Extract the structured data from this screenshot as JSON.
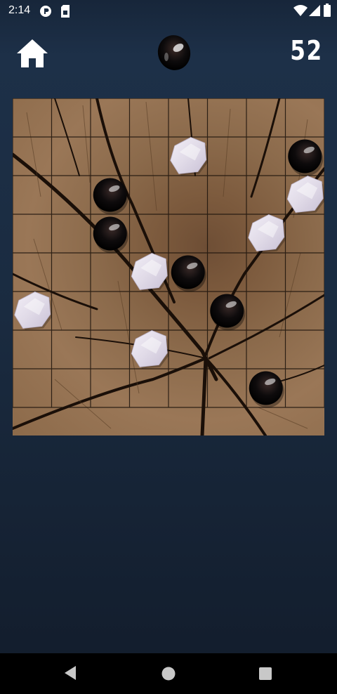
{
  "status_bar": {
    "time": "2:14",
    "icons": [
      "app-notification-icon",
      "sim-card-icon",
      "wifi-icon",
      "signal-icon",
      "battery-icon"
    ]
  },
  "header": {
    "home_icon": "home-icon",
    "current_turn": "black",
    "score": "52"
  },
  "board": {
    "columns": 8,
    "rows": 8,
    "stones": [
      {
        "color": "white",
        "col": 4,
        "row": 1
      },
      {
        "color": "black",
        "col": 7,
        "row": 1
      },
      {
        "color": "black",
        "col": 2,
        "row": 2
      },
      {
        "color": "white",
        "col": 7,
        "row": 2
      },
      {
        "color": "black",
        "col": 2,
        "row": 3
      },
      {
        "color": "white",
        "col": 6,
        "row": 3
      },
      {
        "color": "white",
        "col": 3,
        "row": 4
      },
      {
        "color": "black",
        "col": 4,
        "row": 4
      },
      {
        "color": "white",
        "col": 0,
        "row": 5
      },
      {
        "color": "black",
        "col": 5,
        "row": 5
      },
      {
        "color": "white",
        "col": 3,
        "row": 6
      },
      {
        "color": "black",
        "col": 6,
        "row": 7
      }
    ]
  },
  "navigation": {
    "back_icon": "back-triangle-icon",
    "home_icon": "home-circle-icon",
    "recents_icon": "recents-square-icon"
  }
}
